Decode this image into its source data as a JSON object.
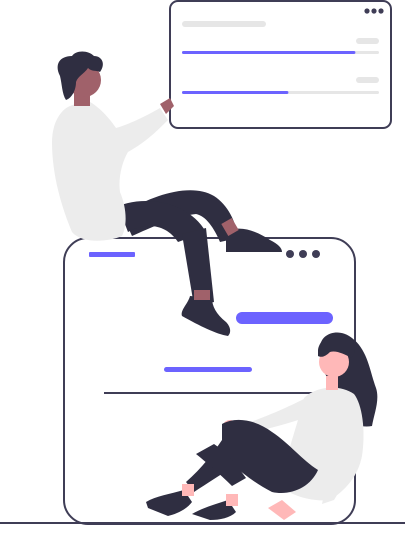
{
  "illustration": {
    "colors": {
      "accent": "#6c63ff",
      "outline": "#3f3d56",
      "dark": "#2f2e41",
      "skin_dark": "#a0616a",
      "skin_light": "#ffb8b8",
      "shirt": "#ececec",
      "placeholder": "#e6e6e6",
      "background": "#ffffff"
    },
    "small_window": {
      "progress_bars": [
        {
          "value": 0.88
        },
        {
          "value": 0.54
        }
      ]
    },
    "icons": [
      "dots-menu-icon",
      "dots-menu-icon"
    ]
  }
}
